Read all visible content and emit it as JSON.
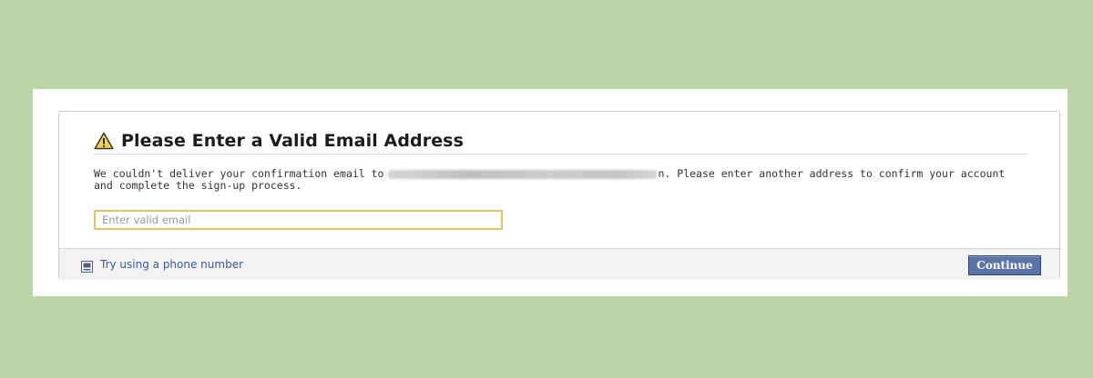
{
  "dialog": {
    "title": "Please Enter a Valid Email Address",
    "title_icon": "warning-triangle-icon",
    "message_before": "We couldn't deliver your confirmation email to",
    "message_after": "n. Please enter another address to confirm your account and complete the sign-up process.",
    "email_input": {
      "placeholder": "Enter valid email",
      "value": ""
    }
  },
  "footer": {
    "phone_link_label": "Try using a phone number",
    "phone_icon": "phone-icon",
    "continue_label": "Continue"
  },
  "colors": {
    "page_background": "#bdd3a8",
    "button_background": "#5b74a8",
    "link_color": "#3b5998",
    "input_focus_border": "#e2c26b"
  }
}
